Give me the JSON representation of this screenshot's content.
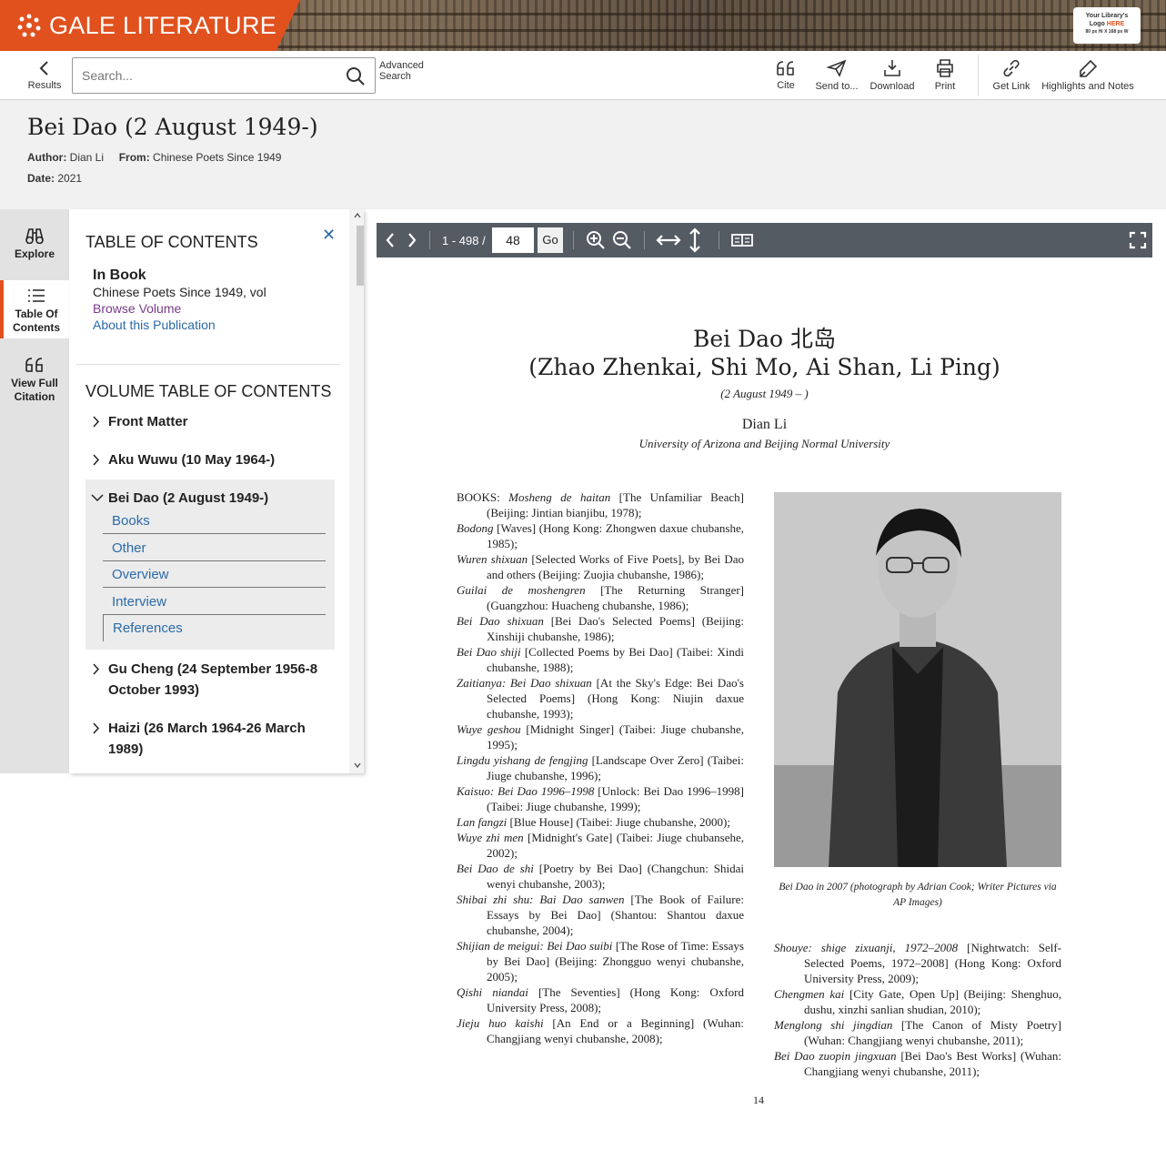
{
  "brand": {
    "name": "GALE LITERATURE",
    "library_logo_line1": "Your Library's",
    "library_logo_line2": "Logo",
    "library_logo_here": "HERE",
    "library_logo_line3": "80 px Hi X 168 px W"
  },
  "toolbar": {
    "results_label": "Results",
    "search_placeholder": "Search...",
    "advanced_line1": "Advanced",
    "advanced_line2": "Search",
    "cite_label": "Cite",
    "send_label": "Send to...",
    "download_label": "Download",
    "print_label": "Print",
    "getlink_label": "Get Link",
    "highlights_label": "Highlights and Notes"
  },
  "document": {
    "title": "Bei Dao (2 August 1949-)",
    "author_label": "Author:",
    "author": "Dian Li",
    "from_label": "From:",
    "from": "Chinese Poets Since 1949",
    "date_label": "Date:",
    "date": "2021"
  },
  "rail": {
    "explore": "Explore",
    "toc_line1": "Table Of",
    "toc_line2": "Contents",
    "citation_line1": "View Full",
    "citation_line2": "Citation"
  },
  "toc": {
    "heading": "TABLE OF CONTENTS",
    "in_book": "In Book",
    "book_title": "Chinese Poets Since 1949, vol",
    "browse_volume": "Browse Volume",
    "about": "About this Publication",
    "volume_heading": "VOLUME TABLE OF CONTENTS",
    "entries": [
      "Front Matter",
      "Aku Wuwu (10 May 1964-)",
      "Bei Dao (2 August 1949-)",
      "Gu Cheng (24 September 1956-8 October 1993)",
      "Haizi (26 March 1964-26 March 1989)"
    ],
    "sub_items": [
      "Books",
      "Other",
      "Overview",
      "Interview",
      "References"
    ]
  },
  "viewer": {
    "page_range": "1 - 498 /",
    "current_page": "48",
    "go_label": "Go"
  },
  "page": {
    "name_line": "Bei Dao  北岛",
    "alt_names": "(Zhao Zhenkai, Shi Mo, Ai Shan, Li Ping)",
    "dates": "(2 August 1949 –    )",
    "author": "Dian Li",
    "affiliation": "University of Arizona and Beijing Normal University",
    "caption": "Bei Dao in 2007 (photograph by Adrian Cook; Writer Pictures via AP Images)",
    "page_number": "14",
    "books_left": [
      {
        "prefix": "BOOKS: ",
        "title": "Mosheng de haitan",
        "rest": " [The Unfamiliar Beach] (Beijing: Jintian bianjibu, 1978);"
      },
      {
        "prefix": "",
        "title": "Bodong",
        "rest": " [Waves] (Hong Kong: Zhongwen daxue chubanshe, 1985);"
      },
      {
        "prefix": "",
        "title": "Wuren shixuan",
        "rest": " [Selected Works of Five Poets], by Bei Dao and others (Beijing: Zuojia chubanshe, 1986);"
      },
      {
        "prefix": "",
        "title": "Guilai de moshengren",
        "rest": " [The Returning Stranger] (Guangzhou: Huacheng chubanshe, 1986);"
      },
      {
        "prefix": "",
        "title": "Bei Dao shixuan",
        "rest": " [Bei Dao's Selected Poems] (Beijing: Xinshiji chubanshe, 1986);"
      },
      {
        "prefix": "",
        "title": "Bei Dao shiji",
        "rest": " [Collected Poems by Bei Dao] (Taibei: Xindi chubanshe, 1988);"
      },
      {
        "prefix": "",
        "title": "Zaitianya: Bei Dao shixuan",
        "rest": " [At the Sky's Edge: Bei Dao's Selected Poems] (Hong Kong: Niujin daxue chubanshe, 1993);"
      },
      {
        "prefix": "",
        "title": "Wuye geshou",
        "rest": " [Midnight Singer] (Taibei: Jiuge chubanshe, 1995);"
      },
      {
        "prefix": "",
        "title": "Lingdu yishang de fengjing",
        "rest": " [Landscape Over Zero] (Taibei: Jiuge chubanshe, 1996);"
      },
      {
        "prefix": "",
        "title": "Kaisuo: Bei Dao 1996–1998",
        "rest": " [Unlock: Bei Dao 1996–1998] (Taibei: Jiuge chubanshe, 1999);"
      },
      {
        "prefix": "",
        "title": "Lan fangzi",
        "rest": " [Blue House] (Taibei: Jiuge chubanshe, 2000);"
      },
      {
        "prefix": "",
        "title": "Wuye zhi men",
        "rest": " [Midnight's Gate] (Taibei: Jiuge chubansehe, 2002);"
      },
      {
        "prefix": "",
        "title": "Bei Dao de shi",
        "rest": " [Poetry by Bei Dao] (Changchun: Shidai wenyi chubanshe, 2003);"
      },
      {
        "prefix": "",
        "title": "Shibai zhi shu: Bai Dao sanwen",
        "rest": " [The Book of Failure: Essays by Bei Dao] (Shantou: Shantou daxue chubanshe, 2004);"
      },
      {
        "prefix": "",
        "title": "Shijian de meigui: Bei Dao suibi",
        "rest": " [The Rose of Time: Essays by Bei Dao] (Beijing: Zhongguo wenyi chubanshe, 2005);"
      },
      {
        "prefix": "",
        "title": "Qishi niandai",
        "rest": " [The Seventies] (Hong Kong: Oxford University Press, 2008);"
      },
      {
        "prefix": "",
        "title": "Jieju huo kaishi",
        "rest": " [An End or a Beginning] (Wuhan: Changjiang wenyi chubanshe, 2008);"
      }
    ],
    "books_right": [
      {
        "prefix": "",
        "title": "Shouye: shige zixuanji, 1972–2008",
        "rest": " [Nightwatch: Self-Selected Poems, 1972–2008] (Hong Kong: Oxford University Press, 2009);"
      },
      {
        "prefix": "",
        "title": "Chengmen kai",
        "rest": " [City Gate, Open Up] (Beijing: Shenghuo, dushu, xinzhi sanlian shudian, 2010);"
      },
      {
        "prefix": "",
        "title": "Menglong shi jingdian",
        "rest": " [The Canon of Misty Poetry] (Wuhan: Changjiang wenyi chubanshe, 2011);"
      },
      {
        "prefix": "",
        "title": "Bei Dao zuopin jingxuan",
        "rest": " [Bei Dao's Best Works] (Wuhan: Changjiang wenyi chubanshe, 2011);"
      }
    ]
  },
  "colors": {
    "brand": "#e0511e",
    "link": "#2a6aa8",
    "viewer_bar": "#545b63"
  }
}
